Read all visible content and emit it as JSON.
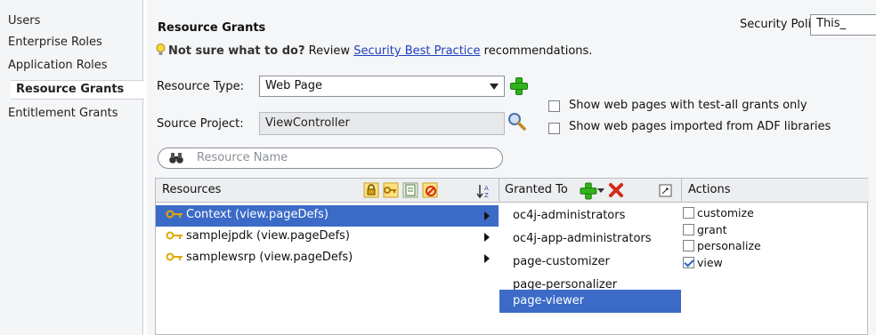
{
  "nav": {
    "items": [
      {
        "label": "Users"
      },
      {
        "label": "Enterprise Roles"
      },
      {
        "label": "Application Roles"
      },
      {
        "label": "Resource Grants"
      },
      {
        "label": "Entitlement Grants"
      }
    ],
    "active": "Resource Grants"
  },
  "header": {
    "title": "Resource Grants",
    "security_policy_label": "Security Policy:",
    "security_policy_value": "This_"
  },
  "hint": {
    "lead": "Not sure what to do?",
    "pre": " Review ",
    "link": "Security Best Practice",
    "post": " recommendations."
  },
  "resource_type": {
    "label": "Resource Type:",
    "value": "Web Page"
  },
  "source_project": {
    "label": "Source Project:",
    "value": "ViewController"
  },
  "options": {
    "test_all": "Show web pages with test-all grants only",
    "adf_libraries": "Show web pages imported from ADF libraries"
  },
  "search": {
    "placeholder": "Resource Name"
  },
  "table": {
    "resources_header": "Resources",
    "granted_to_header": "Granted To",
    "actions_header": "Actions",
    "resources": [
      {
        "label": "Context (view.pageDefs)"
      },
      {
        "label": "samplejpdk (view.pageDefs)"
      },
      {
        "label": "samplewsrp (view.pageDefs)"
      }
    ],
    "granted_to": [
      {
        "label": "oc4j-administrators"
      },
      {
        "label": "oc4j-app-administrators"
      },
      {
        "label": "page-customizer"
      },
      {
        "label": "page-personalizer"
      },
      {
        "label": "page-viewer"
      }
    ],
    "actions": [
      {
        "label": "customize",
        "checked": false
      },
      {
        "label": "grant",
        "checked": false
      },
      {
        "label": "personalize",
        "checked": false
      },
      {
        "label": "view",
        "checked": true
      }
    ]
  },
  "colors": {
    "selection": "#3b6bc7",
    "link": "#1f3fbf",
    "add_green": "#2fb31a",
    "delete_red": "#d42a1a",
    "key_gold": "#e0a800"
  }
}
